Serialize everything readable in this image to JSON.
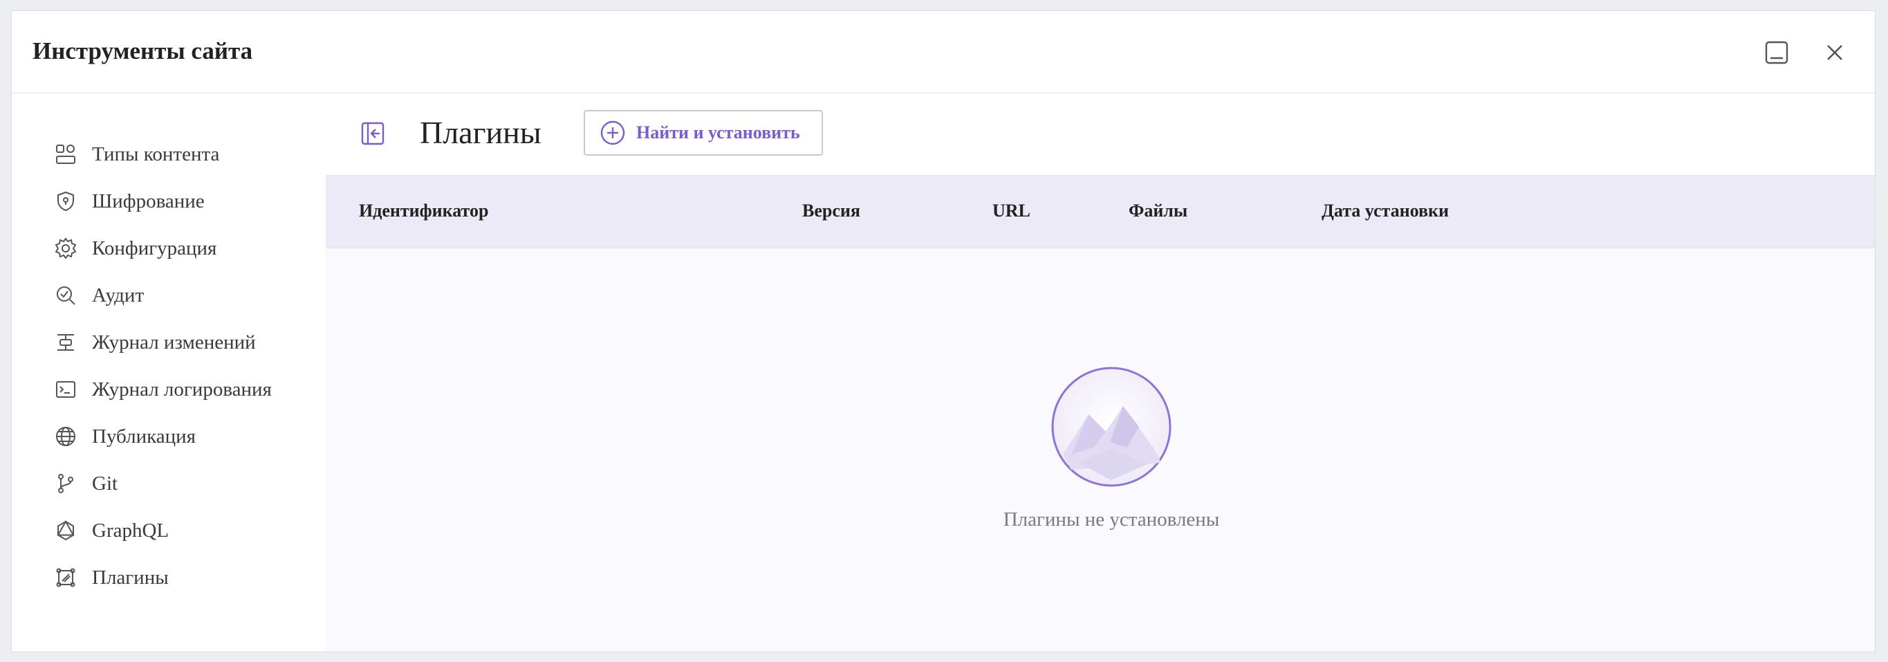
{
  "dialog": {
    "title": "Инструменты сайта",
    "minimize_icon": "minimize-icon",
    "close_icon": "close-icon"
  },
  "sidebar": {
    "items": [
      {
        "label": "Типы контента",
        "icon": "content-types-icon"
      },
      {
        "label": "Шифрование",
        "icon": "shield-icon"
      },
      {
        "label": "Конфигурация",
        "icon": "gear-icon"
      },
      {
        "label": "Аудит",
        "icon": "audit-search-icon"
      },
      {
        "label": "Журнал изменений",
        "icon": "changelog-icon"
      },
      {
        "label": "Журнал логирования",
        "icon": "terminal-icon"
      },
      {
        "label": "Публикация",
        "icon": "globe-publish-icon"
      },
      {
        "label": "Git",
        "icon": "git-branch-icon"
      },
      {
        "label": "GraphQL",
        "icon": "graphql-icon"
      },
      {
        "label": "Плагины",
        "icon": "plugin-icon"
      }
    ]
  },
  "main": {
    "title": "Плагины",
    "collapse_icon": "collapse-sidebar-icon",
    "add_button": "Найти и установить",
    "table": {
      "columns": [
        "Идентификатор",
        "Версия",
        "URL",
        "Файлы",
        "Дата установки"
      ]
    },
    "empty_message": "Плагины не установлены"
  },
  "colors": {
    "accent": "#7a5ccf",
    "table_header_bg": "#eceaf7",
    "content_bg": "#faf9fd"
  }
}
